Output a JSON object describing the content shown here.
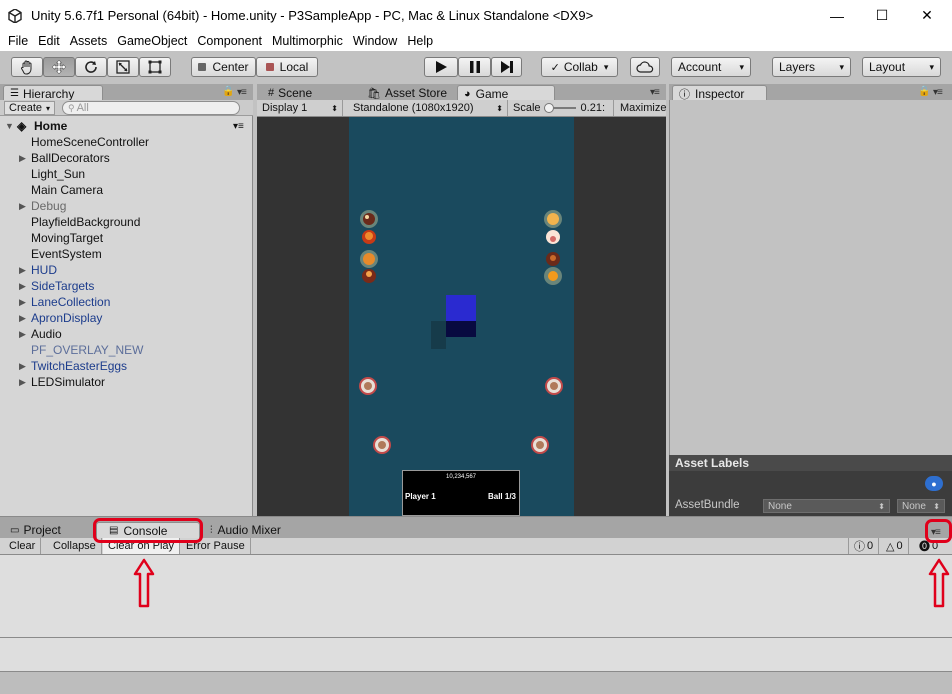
{
  "window": {
    "title": "Unity 5.6.7f1 Personal (64bit) - Home.unity - P3SampleApp - PC, Mac & Linux Standalone <DX9>",
    "controls": [
      "—",
      "☐",
      "✕"
    ]
  },
  "menu": [
    "File",
    "Edit",
    "Assets",
    "GameObject",
    "Component",
    "Multimorphic",
    "Window",
    "Help"
  ],
  "toolbar": {
    "pivot": "Center",
    "space": "Local",
    "collab": "Collab",
    "account": "Account",
    "layers": "Layers",
    "layout": "Layout"
  },
  "hierarchy": {
    "tab": "Hierarchy",
    "create": "Create",
    "search_placeholder": "All",
    "scene": "Home",
    "items": [
      {
        "label": "HomeSceneController",
        "arrow": false,
        "style": "normal"
      },
      {
        "label": "BallDecorators",
        "arrow": true,
        "style": "normal"
      },
      {
        "label": "Light_Sun",
        "arrow": false,
        "style": "normal"
      },
      {
        "label": "Main Camera",
        "arrow": false,
        "style": "normal"
      },
      {
        "label": "Debug",
        "arrow": true,
        "style": "faded"
      },
      {
        "label": "PlayfieldBackground",
        "arrow": false,
        "style": "normal"
      },
      {
        "label": "MovingTarget",
        "arrow": false,
        "style": "normal"
      },
      {
        "label": "EventSystem",
        "arrow": false,
        "style": "normal"
      },
      {
        "label": "HUD",
        "arrow": true,
        "style": "prefab"
      },
      {
        "label": "SideTargets",
        "arrow": true,
        "style": "prefab"
      },
      {
        "label": "LaneCollection",
        "arrow": true,
        "style": "prefab"
      },
      {
        "label": "ApronDisplay",
        "arrow": true,
        "style": "prefab"
      },
      {
        "label": "Audio",
        "arrow": true,
        "style": "normal"
      },
      {
        "label": "PF_OVERLAY_NEW",
        "arrow": false,
        "style": "faded-prefab"
      },
      {
        "label": "TwitchEasterEggs",
        "arrow": true,
        "style": "prefab"
      },
      {
        "label": "LEDSimulator",
        "arrow": true,
        "style": "normal"
      }
    ]
  },
  "center_tabs": {
    "scene": "Scene",
    "asset_store": "Asset Store",
    "game": "Game"
  },
  "game": {
    "display": "Display 1",
    "resolution": "Standalone (1080x1920)",
    "scale_label": "Scale",
    "scale_value": "0.21:",
    "maximize": "Maximize",
    "hud_score": "10,234,567",
    "hud_player": "Player 1",
    "hud_ball": "Ball 1/3"
  },
  "inspector": {
    "tab": "Inspector",
    "asset_labels": "Asset Labels",
    "asset_bundle": "AssetBundle",
    "bundle_value": "None",
    "variant_value": "None"
  },
  "bottom_tabs": {
    "project": "Project",
    "console": "Console",
    "audio_mixer": "Audio Mixer"
  },
  "console": {
    "clear": "Clear",
    "collapse": "Collapse",
    "clear_on_play": "Clear on Play",
    "error_pause": "Error Pause",
    "info_count": "0",
    "warning_count": "0",
    "error_count": "0"
  },
  "colors": {
    "highlight": "#e0001b",
    "playfield": "#1a4a5e",
    "prefab_text": "#1c3c8c"
  }
}
